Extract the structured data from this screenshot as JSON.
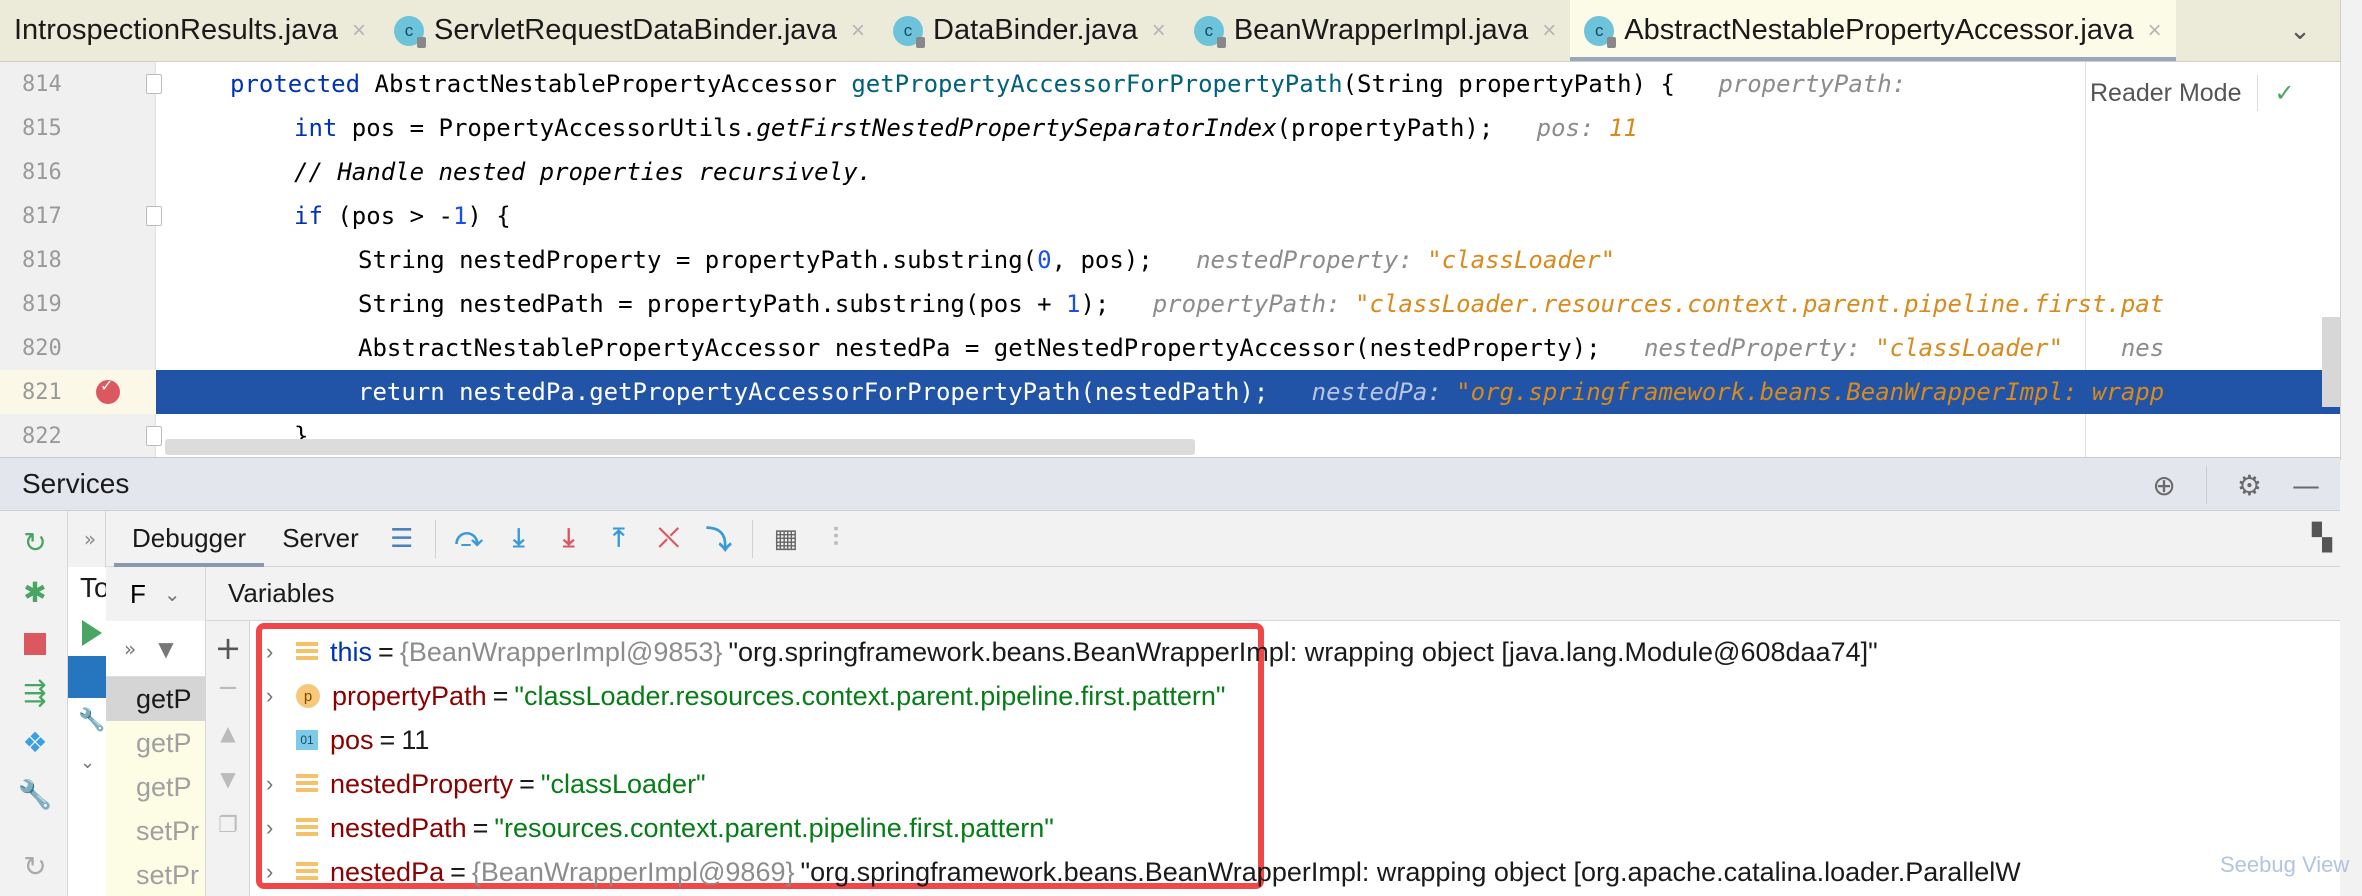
{
  "tabs": [
    {
      "label": "IntrospectionResults.java",
      "active": false,
      "has_icon": false
    },
    {
      "label": "ServletRequestDataBinder.java",
      "active": false,
      "has_icon": true
    },
    {
      "label": "DataBinder.java",
      "active": false,
      "has_icon": true
    },
    {
      "label": "BeanWrapperImpl.java",
      "active": false,
      "has_icon": true
    },
    {
      "label": "AbstractNestablePropertyAccessor.java",
      "active": true,
      "has_icon": true
    }
  ],
  "tab_icon_letter": "c",
  "tab_close_glyph": "×",
  "tab_overflow_glyph": "⌄",
  "editor": {
    "reader_mode_label": "Reader Mode",
    "check_glyph": "✓",
    "lines": [
      {
        "num": "814"
      },
      {
        "num": "815"
      },
      {
        "num": "816"
      },
      {
        "num": "817"
      },
      {
        "num": "818"
      },
      {
        "num": "819"
      },
      {
        "num": "820"
      },
      {
        "num": "821"
      },
      {
        "num": "822"
      }
    ],
    "code": {
      "l814_kw": "protected ",
      "l814_type": "AbstractNestablePropertyAccessor ",
      "l814_fn": "getPropertyAccessorForPropertyPath",
      "l814_rest": "(String propertyPath) {",
      "l814_hint_k": "propertyPath:",
      "l815_kw": "int ",
      "l815_a": "pos = PropertyAccessorUtils.",
      "l815_fn": "getFirstNestedPropertySeparatorIndex",
      "l815_b": "(propertyPath);",
      "l815_hint_k": "pos: ",
      "l815_hint_v": "11",
      "l816_comment": "// Handle nested properties recursively.",
      "l817_kw": "if ",
      "l817_a": "(pos > -",
      "l817_num": "1",
      "l817_b": ") {",
      "l818_a": "String nestedProperty = propertyPath.substring(",
      "l818_num": "0",
      "l818_b": ", pos);",
      "l818_hint_k": "nestedProperty: ",
      "l818_hint_v": "\"classLoader\"",
      "l819_a": "String nestedPath = propertyPath.substring(pos + ",
      "l819_num": "1",
      "l819_b": ");",
      "l819_hint_k": "propertyPath: ",
      "l819_hint_v": "\"classLoader.resources.context.parent.pipeline.first.pat",
      "l820_a": "AbstractNestablePropertyAccessor nestedPa = getNestedPropertyAccessor(nestedProperty);",
      "l820_hint_k": "nestedProperty: ",
      "l820_hint_v": "\"classLoader\"",
      "l820_hint_k2": "nes",
      "l821_a": "return nestedPa.getPropertyAccessorForPropertyPath(nestedPath);",
      "l821_hint_k": "nestedPa: ",
      "l821_hint_v": "\"org.springframework.beans.BeanWrapperImpl: wrapp",
      "l822_a": "}"
    }
  },
  "services": {
    "title": "Services",
    "header_icons": [
      "crosshair-icon",
      "gear-icon",
      "minimize-icon"
    ],
    "toolbar": {
      "more_glyph": "»",
      "tabs": [
        {
          "label": "Debugger",
          "active": true
        },
        {
          "label": "Server",
          "active": false
        }
      ]
    },
    "left_partial_label": "To",
    "frames_header": "F",
    "variables_header": "Variables",
    "frames": [
      {
        "label": "getP",
        "selected": true
      },
      {
        "label": "getP",
        "selected": false
      },
      {
        "label": "getP",
        "selected": false
      },
      {
        "label": "setPr",
        "selected": false
      },
      {
        "label": "setPr",
        "selected": false
      }
    ],
    "variables": [
      {
        "expandable": true,
        "icon": "field",
        "name": "this",
        "kind": "self",
        "type": "{BeanWrapperImpl@9853}",
        "value": "\"org.springframework.beans.BeanWrapperImpl: wrapping object [java.lang.Module@608daa74]\"",
        "value_kind": "plain"
      },
      {
        "expandable": true,
        "icon": "param",
        "name": "propertyPath",
        "kind": "local",
        "type": "",
        "value": "\"classLoader.resources.context.parent.pipeline.first.pattern\"",
        "value_kind": "string"
      },
      {
        "expandable": false,
        "icon": "prim",
        "name": "pos",
        "kind": "local",
        "type": "",
        "value": "11",
        "value_kind": "plain"
      },
      {
        "expandable": true,
        "icon": "field",
        "name": "nestedProperty",
        "kind": "local",
        "type": "",
        "value": "\"classLoader\"",
        "value_kind": "string"
      },
      {
        "expandable": true,
        "icon": "field",
        "name": "nestedPath",
        "kind": "local",
        "type": "",
        "value": "\"resources.context.parent.pipeline.first.pattern\"",
        "value_kind": "string"
      },
      {
        "expandable": true,
        "icon": "field",
        "name": "nestedPa",
        "kind": "local",
        "type": "{BeanWrapperImpl@9869}",
        "value": "\"org.springframework.beans.BeanWrapperImpl: wrapping object [org.apache.catalina.loader.ParallelW",
        "value_kind": "plain"
      }
    ],
    "param_icon_letter": "p",
    "prim_icon_label": "01",
    "watermark": "Seebug View"
  },
  "colors": {
    "current_line": "#2154a6",
    "highlight_box": "#f04848",
    "string_value": "#067d17",
    "hint_value": "#d88a1c"
  }
}
